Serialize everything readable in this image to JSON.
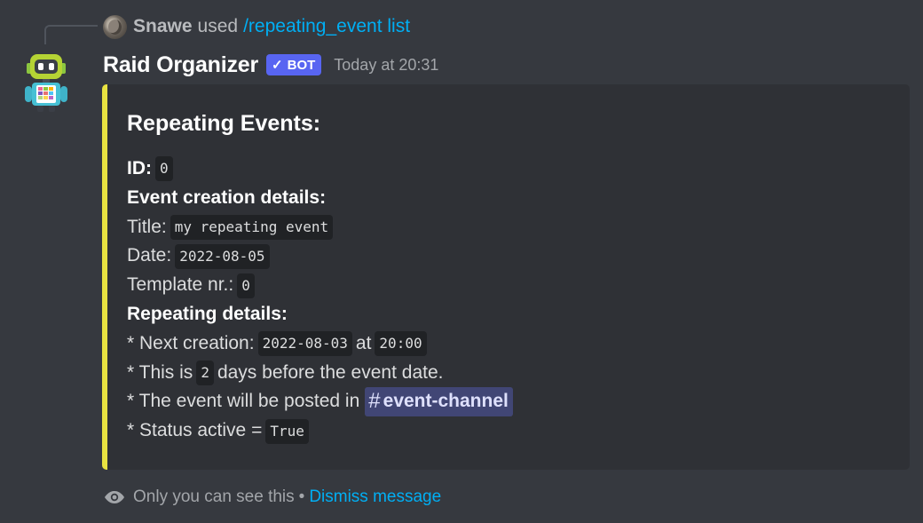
{
  "reply": {
    "username": "Snawe",
    "used_text": "used",
    "command": "/repeating_event list"
  },
  "message": {
    "username": "Raid Organizer",
    "bot_badge": "BOT",
    "timestamp": "Today at 20:31"
  },
  "embed": {
    "accent_color": "#e9e341",
    "title": "Repeating Events:",
    "id_label": "ID:",
    "id_value": "0",
    "creation_header": "Event creation details:",
    "title_label": "Title:",
    "title_value": "my repeating event",
    "date_label": "Date:",
    "date_value": "2022-08-05",
    "template_label": "Template nr.:",
    "template_value": "0",
    "repeating_header": "Repeating details:",
    "next_creation_label": "* Next creation:",
    "next_creation_date": "2022-08-03",
    "at_text": "at",
    "next_creation_time": "20:00",
    "this_is_text": "* This is",
    "days_value": "2",
    "days_text": "days before the event date.",
    "posted_text": "* The event will be posted in",
    "channel_hash": "#",
    "channel_name": "event-channel",
    "status_text": "* Status active =",
    "status_value": "True"
  },
  "footer": {
    "visibility_text": "Only you can see this",
    "bullet": "•",
    "dismiss_label": "Dismiss message"
  }
}
